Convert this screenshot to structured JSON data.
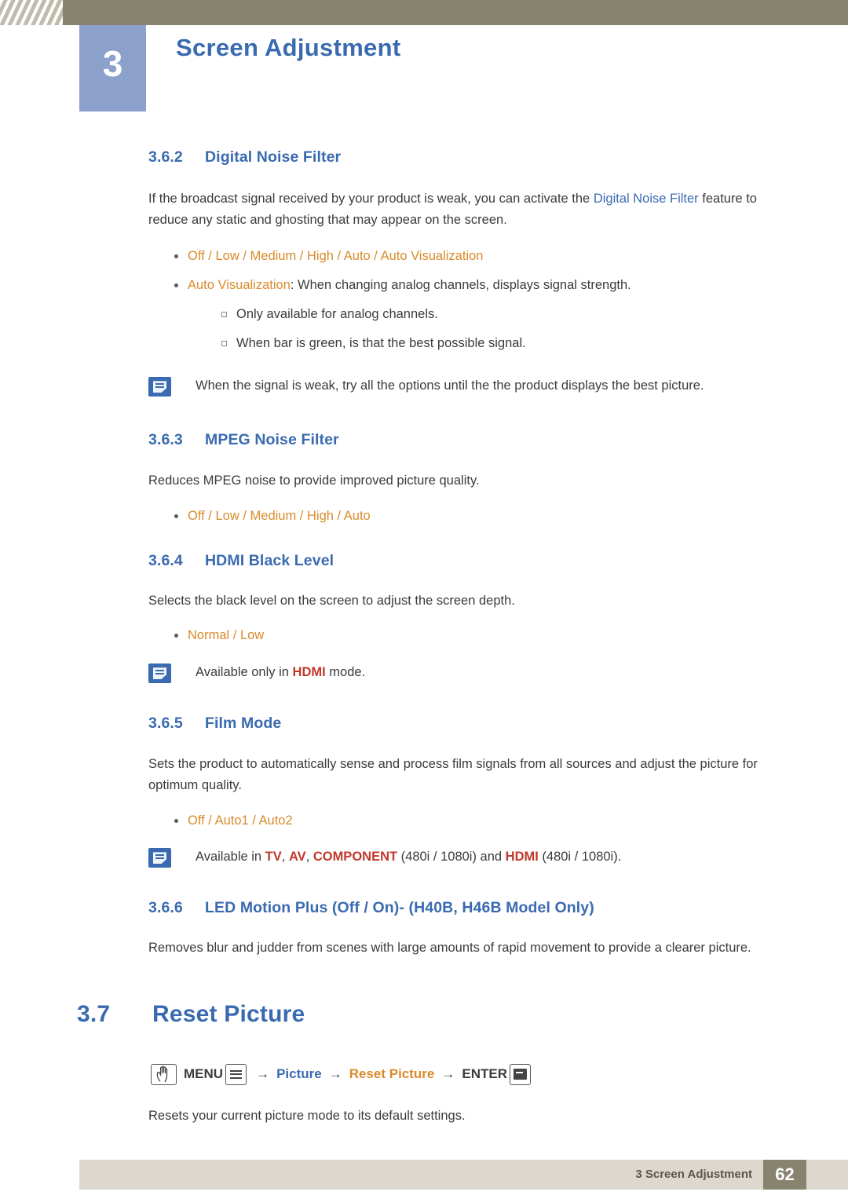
{
  "header": {
    "chapter_number": "3",
    "chapter_title": "Screen Adjustment"
  },
  "sections": {
    "s362": {
      "number": "3.6.2",
      "title": "Digital Noise Filter",
      "para_1a": "If the broadcast signal received by your product is weak, you can activate the ",
      "para_1_hl": "Digital Noise Filter",
      "para_1b": " feature to reduce any static and ghosting that may appear on the screen.",
      "opt_off": "Off",
      "opt_low": "Low",
      "opt_medium": "Medium",
      "opt_high": "High",
      "opt_auto": "Auto",
      "opt_autoviz": "Auto Visualization",
      "bullet2_hl": "Auto Visualization",
      "bullet2_rest": ": When changing analog channels, displays signal strength.",
      "sub1": "Only available for analog channels.",
      "sub2": "When bar is green, is that the best possible signal.",
      "note": "When the signal is weak, try all the options until the the product displays the best picture."
    },
    "s363": {
      "number": "3.6.3",
      "title": "MPEG Noise Filter",
      "para": "Reduces MPEG noise to provide improved picture quality.",
      "opt_off": "Off",
      "opt_low": "Low",
      "opt_medium": "Medium",
      "opt_high": "High",
      "opt_auto": "Auto"
    },
    "s364": {
      "number": "3.6.4",
      "title": "HDMI Black Level",
      "para": "Selects the black level on the screen to adjust the screen depth.",
      "opt_normal": "Normal",
      "opt_low": "Low",
      "note_a": "Available only in ",
      "note_hdmi": "HDMI",
      "note_b": " mode."
    },
    "s365": {
      "number": "3.6.5",
      "title": "Film Mode",
      "para": "Sets the product to automatically sense and process film signals from all sources and adjust the picture for optimum quality.",
      "opt_off": "Off",
      "opt_auto1": "Auto1",
      "opt_auto2": "Auto2",
      "note_a": "Available in ",
      "note_tv": "TV",
      "note_av": "AV",
      "note_component": "COMPONENT",
      "note_b": " (480i / 1080i) and ",
      "note_hdmi": "HDMI",
      "note_c": " (480i / 1080i)."
    },
    "s366": {
      "number": "3.6.6",
      "title": "LED Motion Plus (Off / On)- (H40B, H46B Model Only)",
      "para": "Removes blur and judder from scenes with large amounts of rapid movement to provide a clearer picture."
    },
    "s37": {
      "number": "3.7",
      "title": "Reset Picture",
      "path_menu": "MENU",
      "path_picture": "Picture",
      "path_reset": "Reset Picture",
      "path_enter": "ENTER",
      "arrow": "→",
      "para": "Resets your current picture mode to its default settings."
    }
  },
  "footer": {
    "text": "3 Screen Adjustment",
    "page": "62"
  },
  "colors": {
    "accent_blue": "#3a6ab0",
    "option_orange": "#d98b2b",
    "highlight_red": "#c0392b",
    "header_bar": "#87836f",
    "chapter_block": "#8ca0cc",
    "footer_bar": "#ddd8cf"
  }
}
